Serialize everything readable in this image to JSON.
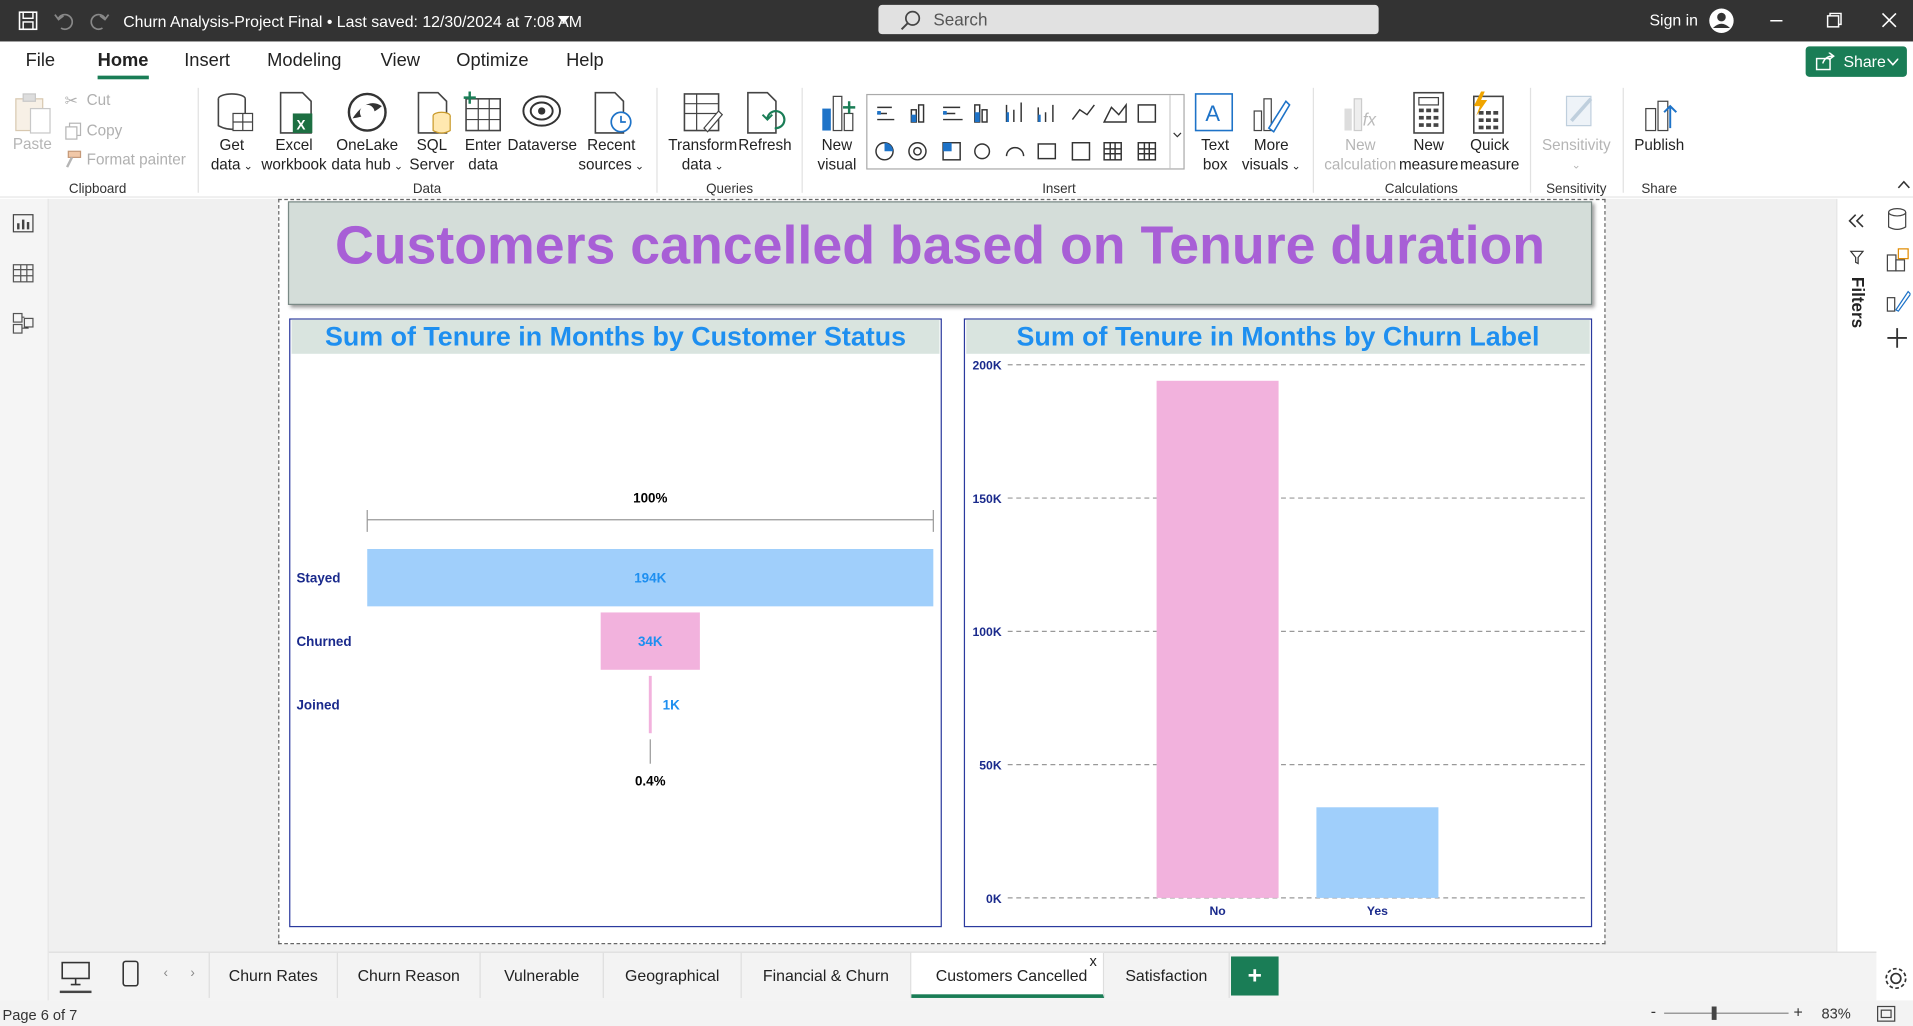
{
  "titlebar": {
    "title": "Churn Analysis-Project Final • Last saved: 12/30/2024 at 7:08 AM",
    "search_placeholder": "Search",
    "signin": "Sign in"
  },
  "menu": [
    "File",
    "Home",
    "Insert",
    "Modeling",
    "View",
    "Optimize",
    "Help"
  ],
  "share_label": "Share",
  "ribbon": {
    "paste": "Paste",
    "cut": "Cut",
    "copy": "Copy",
    "format_painter": "Format painter",
    "clipboard_group": "Clipboard",
    "get_data": [
      "Get",
      "data"
    ],
    "excel": [
      "Excel",
      "workbook"
    ],
    "onelake": [
      "OneLake",
      "data hub"
    ],
    "sql": [
      "SQL",
      "Server"
    ],
    "enter": [
      "Enter",
      "data"
    ],
    "dataverse": "Dataverse",
    "recent": [
      "Recent",
      "sources"
    ],
    "data_group": "Data",
    "transform": [
      "Transform",
      "data"
    ],
    "refresh": "Refresh",
    "queries_group": "Queries",
    "new_visual": [
      "New",
      "visual"
    ],
    "text_box": [
      "Text",
      "box"
    ],
    "more_visuals": [
      "More",
      "visuals"
    ],
    "insert_group": "Insert",
    "new_calc": [
      "New",
      "calculation"
    ],
    "new_measure": [
      "New",
      "measure"
    ],
    "quick_measure": [
      "Quick",
      "measure"
    ],
    "calc_group": "Calculations",
    "sensitivity": "Sensitivity",
    "sensitivity_group": "Sensitivity",
    "publish": "Publish",
    "share_group": "Share"
  },
  "right_panel": {
    "filters": "Filters"
  },
  "report": {
    "banner_title": "Customers cancelled based on Tenure duration",
    "funnel_title": "Sum of Tenure in Months by Customer Status",
    "bar_title": "Sum of Tenure in Months by Churn Label"
  },
  "chart_data": [
    {
      "type": "funnel",
      "title": "Sum of Tenure in Months by Customer Status",
      "categories": [
        "Stayed",
        "Churned",
        "Joined"
      ],
      "values": [
        194000,
        34000,
        1000
      ],
      "data_labels": [
        "194K",
        "34K",
        "1K"
      ],
      "top_percent_label": "100%",
      "bottom_percent_label": "0.4%",
      "colors": [
        "#a0cffb",
        "#f2b2dd",
        "#f2b2dd"
      ]
    },
    {
      "type": "bar",
      "title": "Sum of Tenure in Months by Churn Label",
      "categories": [
        "No",
        "Yes"
      ],
      "values": [
        194000,
        34000
      ],
      "ylim": [
        0,
        200000
      ],
      "yticks": [
        "0K",
        "50K",
        "100K",
        "150K",
        "200K"
      ],
      "grid": true,
      "colors": [
        "#f2b2dd",
        "#a0cffb"
      ]
    }
  ],
  "tabs": [
    "Churn Rates",
    "Churn Reason",
    "Vulnerable",
    "Geographical",
    "Financial & Churn",
    "Customers Cancelled",
    "Satisfaction"
  ],
  "active_tab": "Customers Cancelled",
  "tab_close": "x",
  "status": {
    "page": "Page 6 of 7",
    "zoom": "83%"
  }
}
